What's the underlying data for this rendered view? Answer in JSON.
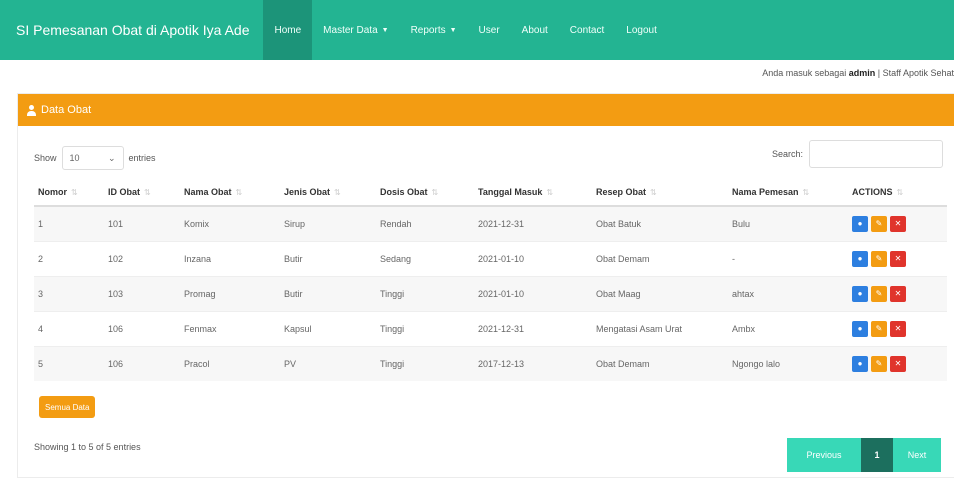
{
  "navbar": {
    "brand": "SI Pemesanan Obat di Apotik Iya Ade",
    "items": [
      {
        "label": "Home",
        "active": true
      },
      {
        "label": "Master Data",
        "dropdown": true
      },
      {
        "label": "Reports",
        "dropdown": true
      },
      {
        "label": "User"
      },
      {
        "label": "About"
      },
      {
        "label": "Contact"
      },
      {
        "label": "Logout"
      }
    ]
  },
  "login": {
    "prefix": "Anda masuk sebagai ",
    "user": "admin",
    "suffix": " | Staff Apotik Sehat"
  },
  "panel": {
    "title": "Data Obat",
    "show_label": "Show",
    "entries_value": "10",
    "entries_label": "entries",
    "search_label": "Search:",
    "search_value": ""
  },
  "table": {
    "headers": [
      "Nomor",
      "ID Obat",
      "Nama Obat",
      "Jenis Obat",
      "Dosis Obat",
      "Tanggal Masuk",
      "Resep Obat",
      "Nama Pemesan",
      "ACTIONS"
    ],
    "rows": [
      [
        "1",
        "101",
        "Komix",
        "Sirup",
        "Rendah",
        "2021-12-31",
        "Obat Batuk",
        "Bulu"
      ],
      [
        "2",
        "102",
        "Inzana",
        "Butir",
        "Sedang",
        "2021-01-10",
        "Obat Demam",
        "-"
      ],
      [
        "3",
        "103",
        "Promag",
        "Butir",
        "Tinggi",
        "2021-01-10",
        "Obat Maag",
        "ahtax"
      ],
      [
        "4",
        "106",
        "Fenmax",
        "Kapsul",
        "Tinggi",
        "2021-12-31",
        "Mengatasi Asam Urat",
        "Ambx"
      ],
      [
        "5",
        "106",
        "Pracol",
        "PV",
        "Tinggi",
        "2017-12-13",
        "Obat Demam",
        "Ngongo lalo"
      ]
    ]
  },
  "buttons": {
    "all_data": "Semua Data"
  },
  "footer": {
    "info": "Showing 1 to 5 of 5 entries",
    "prev": "Previous",
    "current": "1",
    "next": "Next"
  },
  "colors": {
    "navbar": "#23b492",
    "panel_heading": "#f39c12",
    "view": "#2d7fe0",
    "edit": "#f39c12",
    "delete": "#e0342c",
    "pagination": "#38d8b7"
  }
}
